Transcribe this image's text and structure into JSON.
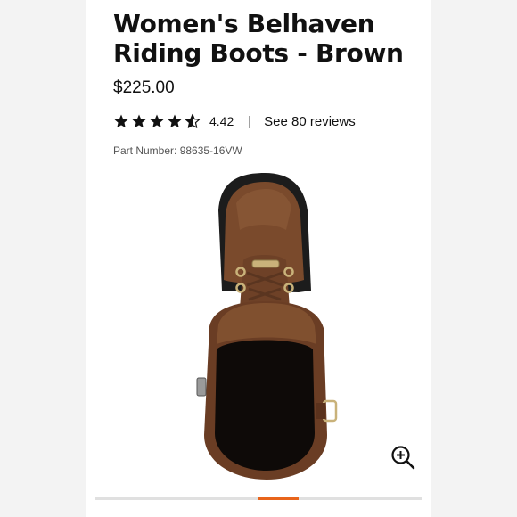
{
  "product": {
    "title": "Women's Belhaven Riding Boots - Brown",
    "price": "$225.00",
    "rating_value": "4.42",
    "rating_stars": 4.42,
    "separator": "|",
    "reviews_link": "See 80 reviews",
    "part_number": "Part Number: 98635-16VW"
  },
  "gallery": {
    "active_index": 3,
    "accent_color": "#e8641b"
  },
  "icons": {
    "stars": [
      "star-full-icon",
      "star-full-icon",
      "star-full-icon",
      "star-full-icon",
      "star-half-icon"
    ],
    "zoom": "zoom-in-icon"
  },
  "colors": {
    "text": "#111111",
    "muted": "#555555",
    "background": "#ffffff"
  }
}
